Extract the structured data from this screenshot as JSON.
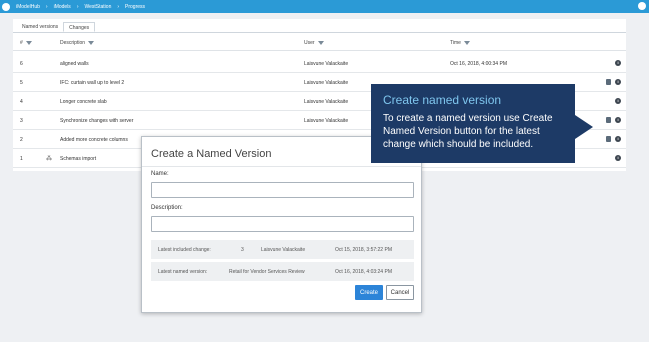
{
  "breadcrumb": [
    "iModelHub",
    "iModels",
    "WestStation",
    "Progress"
  ],
  "tabs": [
    "Named versions",
    "Changes"
  ],
  "columns": {
    "num": "#",
    "description": "Description",
    "user": "User",
    "time": "Time"
  },
  "rows": [
    {
      "num": "6",
      "description": "aligned walls",
      "user": "Laisvune Valackaite",
      "time": "Oct 16, 2018, 4:00:34 PM"
    },
    {
      "num": "5",
      "description": "IFC: curtain wall up to level 2",
      "user": "Laisvune Valackaite",
      "time": ""
    },
    {
      "num": "4",
      "description": "Longer concrete slab",
      "user": "Laisvune Valackaite",
      "time": ""
    },
    {
      "num": "3",
      "description": "Synchronize changes with server",
      "user": "Laisvune Valackaite",
      "time": ""
    },
    {
      "num": "2",
      "description": "Added more concrete columns",
      "user": "",
      "time": ""
    },
    {
      "num": "1",
      "description": "Schemas import",
      "user": "",
      "time": ""
    }
  ],
  "dialog": {
    "title": "Create a Named Version",
    "name_label": "Name:",
    "name_value": "",
    "description_label": "Description:",
    "description_value": "",
    "latest_change_label": "Latest included change:",
    "latest_change_num": "3",
    "latest_change_user": "Laisvune Valackaite",
    "latest_change_time": "Oct 15, 2018, 3:57:22 PM",
    "latest_named_label": "Latest named version:",
    "latest_named_name": "Retail for Vendor Services Review",
    "latest_named_time": "Oct 16, 2018, 4:03:24 PM",
    "create_label": "Create",
    "cancel_label": "Cancel"
  },
  "callout": {
    "title": "Create named version",
    "body": "To create a named version use Create Named Version button for the latest change which should be included."
  },
  "colors": {
    "topbar": "#2b9ad6",
    "callout": "#1d3a66",
    "primary": "#2c84d8"
  }
}
